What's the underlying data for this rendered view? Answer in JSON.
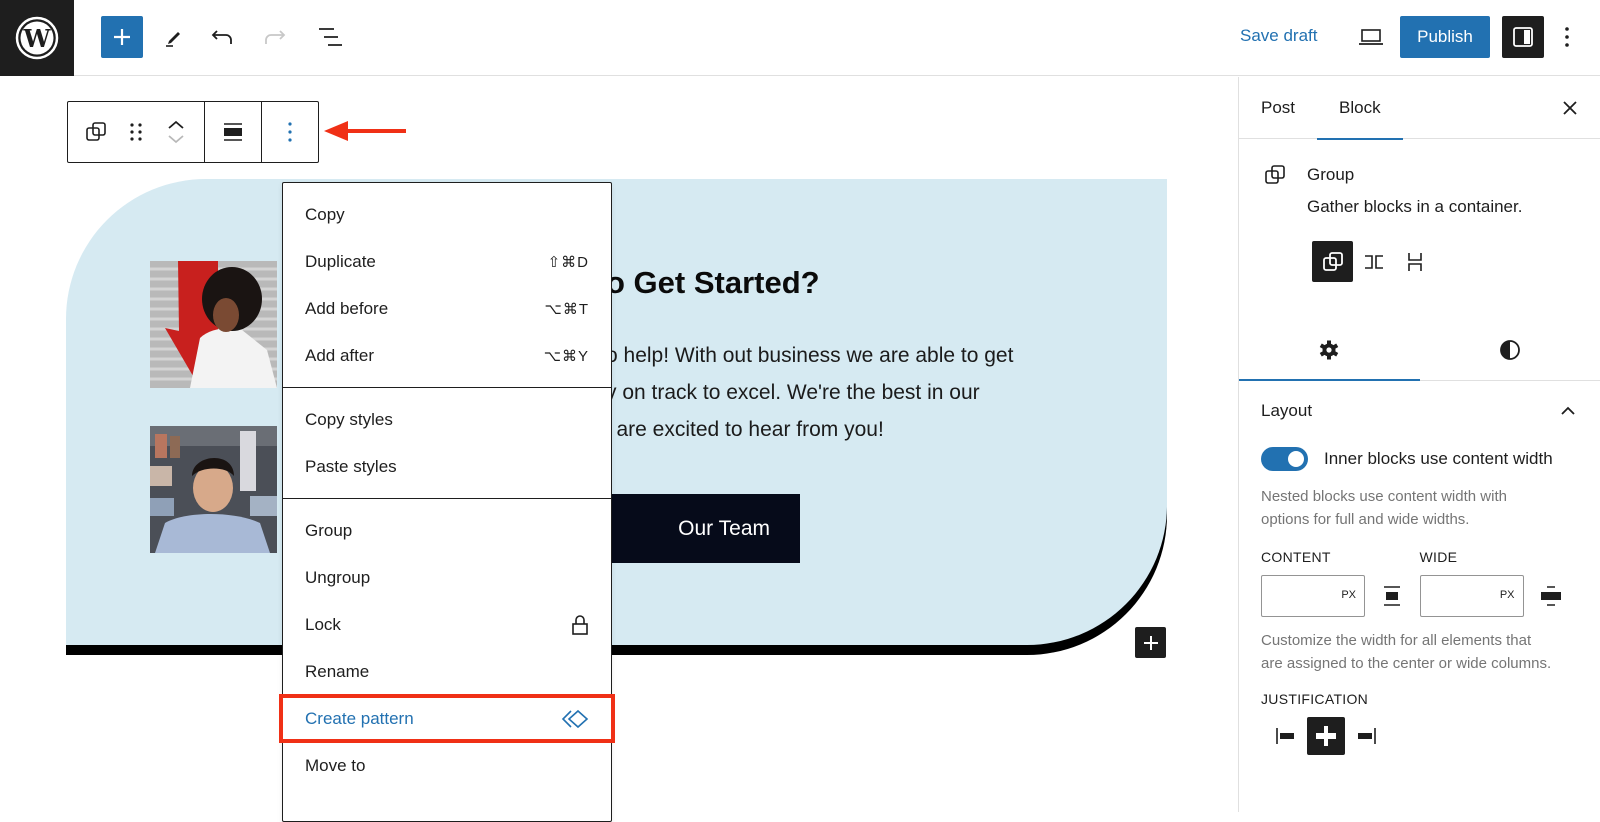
{
  "topbar": {
    "logo": "wordpress-logo",
    "tools": [
      {
        "name": "add-block",
        "icon": "plus-icon"
      },
      {
        "name": "tools",
        "icon": "pencil-icon"
      },
      {
        "name": "undo",
        "icon": "undo-icon"
      },
      {
        "name": "redo",
        "icon": "redo-icon"
      },
      {
        "name": "document-overview",
        "icon": "list-view-icon"
      }
    ],
    "save_draft_label": "Save draft",
    "preview_icon": "laptop-icon",
    "publish_label": "Publish",
    "settings_icon": "sidebar-icon",
    "options_icon": "more-vertical-icon"
  },
  "block_toolbar": {
    "buttons": [
      "group-icon",
      "drag-handle-icon",
      "move-up-icon",
      "move-down-icon",
      "align-icon",
      "more-options-icon"
    ]
  },
  "canvas": {
    "heading": "Ready to Get Started?",
    "heading_visible": "o Get Started?",
    "paragraph_lines": [
      "o help! With out business we are able to get",
      "y on track to excel. We're the best in our",
      "l are excited to hear from you!"
    ],
    "button_label": "Our Team",
    "photos": [
      "woman-portrait",
      "man-portrait"
    ],
    "colors": {
      "group_bg": "#d6eaf2",
      "button_bg": "#060b1a",
      "accent": "#2271b1",
      "highlight": "#f03016"
    }
  },
  "menu": {
    "sections": [
      {
        "items": [
          {
            "label": "Copy",
            "shortcut": ""
          },
          {
            "label": "Duplicate",
            "shortcut": "⇧⌘D"
          },
          {
            "label": "Add before",
            "shortcut": "⌥⌘T"
          },
          {
            "label": "Add after",
            "shortcut": "⌥⌘Y"
          }
        ]
      },
      {
        "items": [
          {
            "label": "Copy styles",
            "shortcut": ""
          },
          {
            "label": "Paste styles",
            "shortcut": ""
          }
        ]
      },
      {
        "items": [
          {
            "label": "Group",
            "shortcut": ""
          },
          {
            "label": "Ungroup",
            "shortcut": ""
          },
          {
            "label": "Lock",
            "icon": "lock-icon"
          },
          {
            "label": "Rename",
            "shortcut": ""
          },
          {
            "label": "Create pattern",
            "icon": "symbol-icon",
            "highlighted": true
          },
          {
            "label": "Move to",
            "shortcut": ""
          }
        ]
      }
    ]
  },
  "sidebar": {
    "tabs": [
      {
        "label": "Post",
        "active": false
      },
      {
        "label": "Block",
        "active": true
      }
    ],
    "block": {
      "title": "Group",
      "description": "Gather blocks in a container.",
      "variations": [
        "group",
        "row",
        "stack"
      ],
      "active_variation": "group"
    },
    "subtabs": [
      {
        "name": "settings",
        "icon": "gear-icon",
        "active": true
      },
      {
        "name": "styles",
        "icon": "contrast-icon",
        "active": false
      }
    ],
    "layout": {
      "title": "Layout",
      "toggle_label": "Inner blocks use content width",
      "toggle_on": true,
      "toggle_help": [
        "Nested blocks use content width with",
        "options for full and wide widths."
      ],
      "content_label": "CONTENT",
      "content_value": "",
      "content_unit": "PX",
      "wide_label": "WIDE",
      "wide_value": "",
      "wide_unit": "PX",
      "width_help": [
        "Customize the width for all elements that",
        "are assigned to the center or wide columns."
      ],
      "justification_label": "JUSTIFICATION",
      "justification_options": [
        "left",
        "center",
        "right"
      ],
      "justification_active": "center"
    }
  }
}
